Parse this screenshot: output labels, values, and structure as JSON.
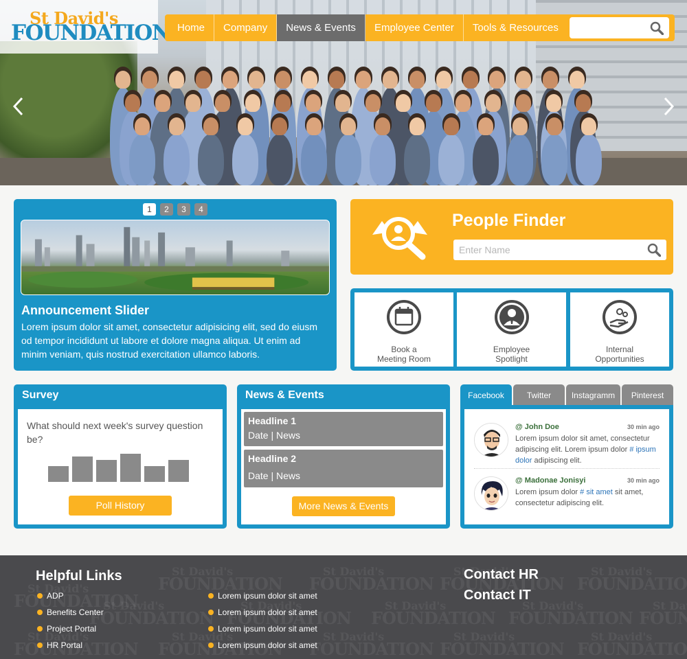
{
  "logo": {
    "line1": "St David's",
    "line2": "FOUNDATION"
  },
  "nav": {
    "items": [
      "Home",
      "Company",
      "News & Events",
      "Employee Center",
      "Tools & Resources"
    ],
    "active": "News & Events",
    "search_placeholder": ""
  },
  "hero": {
    "prev_icon": "chevron-left-icon",
    "next_icon": "chevron-right-icon"
  },
  "announcement": {
    "pages": [
      "1",
      "2",
      "3",
      "4"
    ],
    "current_page": "1",
    "title": "Announcement Slider",
    "text": "Lorem ipsum dolor sit amet, consectetur adipisicing elit, sed do eiusm od tempor incididunt ut labore et dolore magna aliqua. Ut enim ad minim veniam, quis nostrud exercitation ullamco laboris."
  },
  "people_finder": {
    "title": "People Finder",
    "placeholder": "Enter Name",
    "icon": "people-search-icon"
  },
  "quick_links": [
    {
      "label_line1": "Book a",
      "label_line2": "Meeting Room",
      "icon": "calendar-icon"
    },
    {
      "label_line1": "Employee",
      "label_line2": "Spotlight",
      "icon": "employee-icon"
    },
    {
      "label_line1": "Internal",
      "label_line2": "Opportunities",
      "icon": "opportunities-icon"
    }
  ],
  "survey": {
    "title": "Survey",
    "question": "What should next week's survey question be?",
    "bar_values": [
      0.5,
      0.8,
      0.7,
      0.9,
      0.5,
      0.7
    ],
    "button": "Poll History"
  },
  "news": {
    "title": "News & Events",
    "items": [
      {
        "headline": "Headline 1",
        "meta": "Date | News"
      },
      {
        "headline": "Headline 2",
        "meta": "Date | News"
      }
    ],
    "button": "More News & Events"
  },
  "social": {
    "tabs": [
      "Facebook",
      "Twitter",
      "Instagramm",
      "Pinterest"
    ],
    "active_tab": "Facebook",
    "posts": [
      {
        "user": "@ John Doe",
        "time": "30 min ago",
        "text_a": "Lorem ipsum dolor sit amet, consectetur adipiscing elit. Lorem ipsum dolor ",
        "hashtag": "# ipsum dolor",
        "text_b": " adipiscing elit."
      },
      {
        "user": "@ Madonae Jonisyi",
        "time": "30 min ago",
        "text_a": "Lorem ipsum dolor ",
        "hashtag": "# sit amet",
        "text_b": " sit amet, consectetur adipiscing elit."
      }
    ]
  },
  "footer": {
    "helpful_title": "Helpful Links",
    "links_col1": [
      "ADP",
      "Benefits Center",
      "Project Portal",
      "HR Portal"
    ],
    "links_col2": [
      "Lorem ipsum dolor sit amet",
      "Lorem ipsum dolor sit amet",
      "Lorem ipsum dolor sit amet",
      "Lorem ipsum dolor sit amet"
    ],
    "contact_hr": "Contact HR",
    "contact_it": "Contact IT"
  },
  "colors": {
    "blue": "#1a95c7",
    "yellow": "#fbb322",
    "gray": "#8a8a8a",
    "footer": "#4a4a4d"
  }
}
